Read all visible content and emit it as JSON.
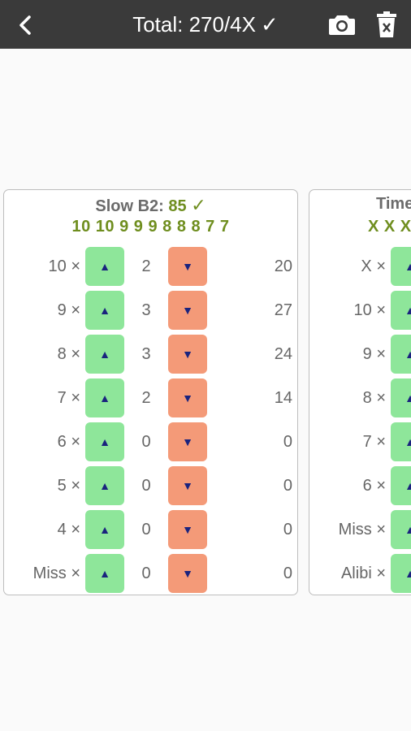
{
  "header": {
    "title": "Total: 270/4X",
    "check": "✓",
    "back_icon": "back-arrow-icon",
    "camera_icon": "camera-icon",
    "trash_icon": "trash-icon",
    "bar_color": "#3a3a3a"
  },
  "cards": [
    {
      "title_label": "Slow B2:",
      "title_score": "85",
      "title_check": "✓",
      "sequence": "10 10 9 9 9 8 8 8 7 7",
      "rows": [
        {
          "label": "10 ×",
          "count": "2",
          "total": "20"
        },
        {
          "label": "9 ×",
          "count": "3",
          "total": "27"
        },
        {
          "label": "8 ×",
          "count": "3",
          "total": "24"
        },
        {
          "label": "7 ×",
          "count": "2",
          "total": "14"
        },
        {
          "label": "6 ×",
          "count": "0",
          "total": "0"
        },
        {
          "label": "5 ×",
          "count": "0",
          "total": "0"
        },
        {
          "label": "4 ×",
          "count": "0",
          "total": "0"
        },
        {
          "label": "Miss ×",
          "count": "0",
          "total": "0"
        }
      ]
    },
    {
      "title_label": "Time",
      "sequence": "X X X",
      "rows": [
        {
          "label": "X ×"
        },
        {
          "label": "10 ×"
        },
        {
          "label": "9 ×"
        },
        {
          "label": "8 ×"
        },
        {
          "label": "7 ×"
        },
        {
          "label": "6 ×"
        },
        {
          "label": "Miss ×"
        },
        {
          "label": "Alibi ×"
        }
      ]
    }
  ],
  "buttons": {
    "up_glyph": "▲",
    "down_glyph": "▼",
    "up_color": "#8ee69a",
    "down_color": "#f49a78"
  }
}
